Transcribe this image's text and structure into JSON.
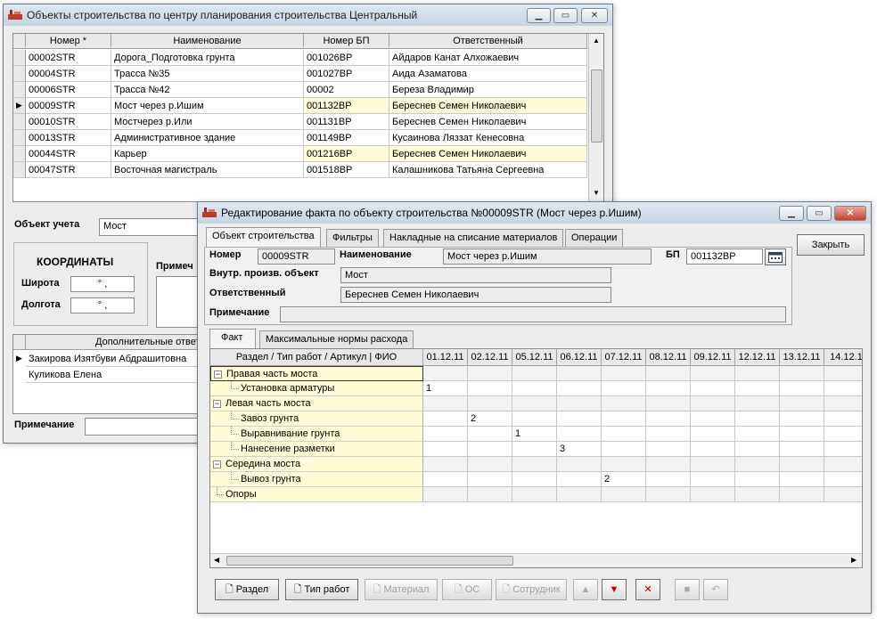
{
  "win1": {
    "title": "Объекты строительства по центру планирования строительства Центральный",
    "columns": [
      "Номер *",
      "Наименование",
      "Номер БП",
      "Ответственный"
    ],
    "rows": [
      [
        "00002STR",
        "Дорога_Подготовка грунта",
        "001026BP",
        "Айдаров Канат Алхожаевич"
      ],
      [
        "00004STR",
        "Трасса №35",
        "001027BP",
        "Аида Азаматова"
      ],
      [
        "00006STR",
        "Трасса №42",
        "00002",
        "Береза Владимир"
      ],
      [
        "00009STR",
        "Мост через р.Ишим",
        "001132BP",
        "Береснев Семен Николаевич"
      ],
      [
        "00010STR",
        "Мостчерез р.Или",
        "001131BP",
        "Береснев Семен Николаевич"
      ],
      [
        "00013STR",
        "Административное здание",
        "001149BP",
        "Кусаинова Ляззат Кенесовна"
      ],
      [
        "00044STR",
        "Карьер",
        "001216BP",
        "Береснев Семен Николаевич"
      ],
      [
        "00047STR",
        "Восточная магистраль",
        "001518BP",
        "Калашникова  Татьяна Сергеевна"
      ]
    ],
    "object_label": "Объект учета",
    "object_value": "Мост",
    "coords_title": "КООРДИНАТЫ",
    "lat_label": "Широта",
    "lat_value": "°  ,",
    "lon_label": "Долгота",
    "lon_value": "°  ,",
    "note_label_short": "Примеч",
    "extra_header": "Дополнительные ответ",
    "extra_rows": [
      "Закирова Изятбуви Абдрашитовна",
      "Куликова Елена"
    ],
    "note_label": "Примечание"
  },
  "win2": {
    "title": "Редактирование факта по объекту строительства №00009STR (Мост через р.Ишим)",
    "tabs": [
      "Объект строительства",
      "Фильтры",
      "Накладные на списание материалов",
      "Операции"
    ],
    "close_button": "Закрыть",
    "number_label": "Номер",
    "number_value": "00009STR",
    "name_label": "Наименование",
    "name_value": "Мост через р.Ишим",
    "bp_label": "БП",
    "bp_value": "001132BP",
    "inner_label": "Внутр. произв. объект",
    "inner_value": "Мост",
    "resp_label": "Ответственный",
    "resp_value": "Береснев Семен Николаевич",
    "note_label": "Примечание",
    "note_value": "",
    "subtabs": [
      "Факт",
      "Максимальные нормы расхода"
    ],
    "grid_header": "Раздел / Тип работ / Артикул | ФИО",
    "dates": [
      "01.12.11",
      "02.12.11",
      "05.12.11",
      "06.12.11",
      "07.12.11",
      "08.12.11",
      "09.12.11",
      "12.12.11",
      "13.12.11",
      "14.12.1"
    ],
    "tree": [
      {
        "label": "Правая часть моста",
        "level": 0,
        "values": [
          "",
          "",
          "",
          "",
          "",
          "",
          "",
          "",
          "",
          ""
        ]
      },
      {
        "label": "Установка арматуры",
        "level": 1,
        "values": [
          "1",
          "",
          "",
          "",
          "",
          "",
          "",
          "",
          "",
          ""
        ]
      },
      {
        "label": "Левая часть моста",
        "level": 0,
        "values": [
          "",
          "",
          "",
          "",
          "",
          "",
          "",
          "",
          "",
          ""
        ]
      },
      {
        "label": "Завоз грунта",
        "level": 1,
        "values": [
          "",
          "2",
          "",
          "",
          "",
          "",
          "",
          "",
          "",
          ""
        ]
      },
      {
        "label": "Выравнивание грунта",
        "level": 1,
        "values": [
          "",
          "",
          "1",
          "",
          "",
          "",
          "",
          "",
          "",
          ""
        ]
      },
      {
        "label": "Нанесение разметки",
        "level": 1,
        "values": [
          "",
          "",
          "",
          "3",
          "",
          "",
          "",
          "",
          "",
          ""
        ]
      },
      {
        "label": "Середина моста",
        "level": 0,
        "values": [
          "",
          "",
          "",
          "",
          "",
          "",
          "",
          "",
          "",
          ""
        ]
      },
      {
        "label": "Вывоз грунта",
        "level": 1,
        "values": [
          "",
          "",
          "",
          "",
          "2",
          "",
          "",
          "",
          "",
          ""
        ]
      },
      {
        "label": "Опоры",
        "level": 0,
        "values": [
          "",
          "",
          "",
          "",
          "",
          "",
          "",
          "",
          "",
          ""
        ]
      }
    ],
    "buttons": {
      "section": "Раздел",
      "work_type": "Тип работ",
      "material": "Материал",
      "os": "ОС",
      "employee": "Сотрудник"
    }
  }
}
